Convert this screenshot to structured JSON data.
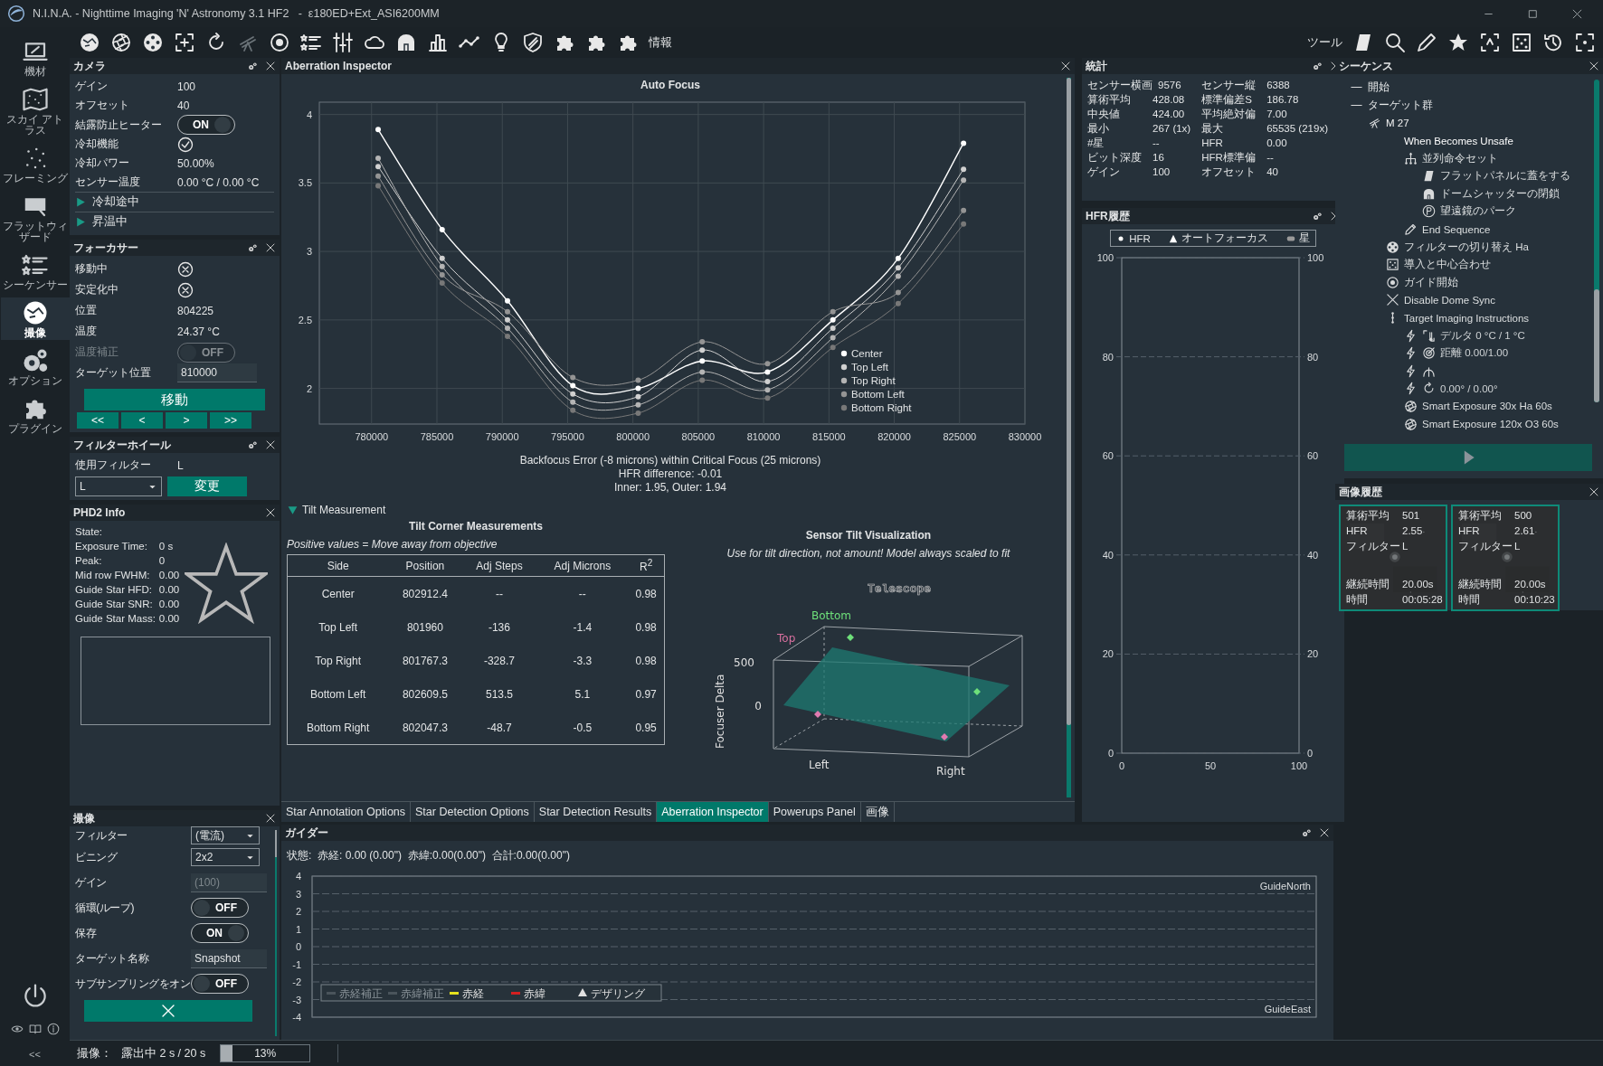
{
  "window": {
    "title": "N.I.N.A. - Nighttime Imaging 'N' Astronomy 3.1 HF2   -  ε180ED+Ext_ASI6200MM"
  },
  "nav": [
    {
      "label": "機材",
      "selected": false
    },
    {
      "label": "スカイ アトラス",
      "selected": false
    },
    {
      "label": "フレーミング",
      "selected": false
    },
    {
      "label": "フラットウィザード",
      "selected": false
    },
    {
      "label": "シーケンサー",
      "selected": false
    },
    {
      "label": "撮像",
      "selected": true
    },
    {
      "label": "オプション",
      "selected": false
    },
    {
      "label": "プラグイン",
      "selected": false
    }
  ],
  "nav_collapse": "<<",
  "toolbar": {
    "info_label": "情報",
    "tools_label": "ツール"
  },
  "camera": {
    "title": "カメラ",
    "settings_button": true,
    "rows": [
      {
        "kind": "text",
        "label": "ゲイン",
        "value": "100"
      },
      {
        "kind": "text",
        "label": "オフセット",
        "value": "40"
      },
      {
        "kind": "toggle",
        "label": "結露防止ヒーター",
        "value": "ON",
        "on": true,
        "disabled": false
      },
      {
        "kind": "check",
        "label": "冷却機能",
        "checked": true
      },
      {
        "kind": "text",
        "label": "冷却パワー",
        "value": "50.00%"
      },
      {
        "kind": "text",
        "label": "センサー温度",
        "value": "0.00 °C / 0.00 °C"
      },
      {
        "kind": "expander",
        "label": "冷却途中",
        "expanded": false
      },
      {
        "kind": "expander",
        "label": "昇温中",
        "expanded": false
      }
    ]
  },
  "focuser": {
    "title": "フォーカサー",
    "settings_button": true,
    "rows": [
      {
        "kind": "check",
        "label": "移動中",
        "checked": false
      },
      {
        "kind": "check",
        "label": "安定化中",
        "checked": false
      },
      {
        "kind": "text",
        "label": "位置",
        "value": "804225"
      },
      {
        "kind": "text",
        "label": "温度",
        "value": "24.37 °C"
      },
      {
        "kind": "toggle",
        "label": "温度補正",
        "value": "OFF",
        "on": false,
        "disabled": true
      },
      {
        "kind": "input",
        "label": "ターゲット位置",
        "value": "810000"
      }
    ],
    "move_button": "移動",
    "step_buttons": [
      "<<",
      "<",
      ">",
      ">>"
    ]
  },
  "filter_wheel": {
    "title": "フィルターホイール",
    "settings_button": true,
    "rows": [
      {
        "kind": "text",
        "label": "使用フィルター",
        "value": "L"
      }
    ],
    "filter_select": "L",
    "change_button": "変更"
  },
  "phd2": {
    "title": "PHD2 Info",
    "settings_button": false,
    "rows": [
      {
        "label": "State:"
      },
      {
        "label": "Exposure Time:",
        "value": "0 s"
      },
      {
        "label": "Peak:",
        "value": "0"
      },
      {
        "label": "Mid row FWHM:",
        "value": "0.00"
      },
      {
        "label": "Guide Star HFD:",
        "value": "0.00"
      },
      {
        "label": "Guide Star SNR:",
        "value": "0.00"
      },
      {
        "label": "Guide Star Mass:",
        "value": "0.00"
      }
    ]
  },
  "imaging": {
    "title": "撮像",
    "settings_button": false,
    "rows": [
      {
        "kind": "dropdown",
        "label": "フィルター",
        "value": "(電流)"
      },
      {
        "kind": "dropdown",
        "label": "ビニング",
        "value": "2x2"
      },
      {
        "kind": "input",
        "label": "ゲイン",
        "placeholder": "(100)"
      },
      {
        "kind": "toggle",
        "label": "循環(ループ)",
        "value": "OFF",
        "on": false,
        "disabled": false
      },
      {
        "kind": "toggle",
        "label": "保存",
        "value": "ON",
        "on": true,
        "disabled": false
      },
      {
        "kind": "input",
        "label": "ターゲット名称",
        "value": "Snapshot"
      },
      {
        "kind": "toggle",
        "label": "サブサンプリングをオン",
        "value": "OFF",
        "on": false,
        "disabled": false
      }
    ]
  },
  "aberration": {
    "title": "Aberration Inspector",
    "chart_data": {
      "type": "line",
      "title": "Auto Focus",
      "grid": true,
      "legend": "lower right",
      "xlim": [
        776000,
        830000
      ],
      "ylim": [
        1.74,
        4.09
      ],
      "xticks": [
        780000,
        785000,
        790000,
        795000,
        800000,
        805000,
        810000,
        815000,
        820000,
        825000,
        830000
      ],
      "yticks": [
        2,
        2.5,
        3,
        3.5,
        4
      ],
      "x": [
        780500,
        785400,
        790400,
        795400,
        800400,
        805300,
        810300,
        815300,
        820300,
        825300
      ],
      "series": [
        {
          "name": "Center",
          "color": "#ffffff",
          "marker": "circle",
          "values": [
            3.89,
            3.16,
            2.64,
            2.02,
            2.0,
            2.2,
            2.12,
            2.5,
            2.95,
            3.79
          ]
        },
        {
          "name": "Top Left",
          "color": "#d0d0d0",
          "marker": "circle",
          "values": [
            3.62,
            2.95,
            2.5,
            1.96,
            1.94,
            2.28,
            2.05,
            2.44,
            2.88,
            3.6
          ]
        },
        {
          "name": "Top Right",
          "color": "#b4b4b4",
          "marker": "circle",
          "values": [
            3.68,
            2.89,
            2.44,
            1.9,
            1.88,
            2.12,
            1.99,
            2.37,
            2.82,
            3.52
          ]
        },
        {
          "name": "Bottom Left",
          "color": "#949494",
          "marker": "circle",
          "values": [
            3.55,
            2.83,
            2.56,
            2.08,
            2.06,
            2.34,
            2.18,
            2.56,
            2.7,
            3.3
          ]
        },
        {
          "name": "Bottom Right",
          "color": "#787878",
          "marker": "circle",
          "values": [
            3.48,
            2.77,
            2.38,
            1.84,
            1.82,
            2.06,
            1.93,
            2.3,
            2.62,
            3.2
          ]
        }
      ]
    },
    "focus_summary": [
      "Backfocus Error (-8 microns) within Critical Focus (25 microns)",
      "HFR difference: -0.01",
      "Inner: 1.95, Outer: 1.94"
    ],
    "tilt": {
      "section": "Tilt Measurement",
      "expanded": true,
      "table_title": "Tilt Corner Measurements",
      "note": "Positive values = Move away from objective",
      "columns": [
        "Side",
        "Position",
        "Adj Steps",
        "Adj Microns",
        "R$^{2}$"
      ],
      "rows": [
        [
          "Center",
          "802912.4",
          "--",
          "--",
          "0.98"
        ],
        [
          "Top Left",
          "801960",
          "-136",
          "-1.4",
          "0.98"
        ],
        [
          "Top Right",
          "801767.3",
          "-328.7",
          "-3.3",
          "0.98"
        ],
        [
          "Bottom Left",
          "802609.5",
          "513.5",
          "5.1",
          "0.97"
        ],
        [
          "Bottom Right",
          "802047.3",
          "-48.7",
          "-0.5",
          "0.95"
        ]
      ]
    },
    "visual": {
      "title": "Sensor Tilt Visualization",
      "subtitle": "Use for tilt direction, not amount! Model always scaled to fit",
      "plot_title": "Telescope",
      "top": "Top",
      "bottom": "Bottom",
      "left": "Left",
      "right": "Right",
      "axis_label": "Focuser Delta",
      "ticks": [
        "500",
        "0"
      ]
    }
  },
  "center_tabs": [
    {
      "label": "Star Annotation Options",
      "selected": false
    },
    {
      "label": "Star Detection Options",
      "selected": false
    },
    {
      "label": "Star Detection Results",
      "selected": false
    },
    {
      "label": "Aberration Inspector",
      "selected": true
    },
    {
      "label": "Powerups Panel",
      "selected": false
    },
    {
      "label": "画像",
      "selected": false
    }
  ],
  "stats": {
    "title": "統計",
    "settings_button": true,
    "left": [
      {
        "label": "センサー横画",
        "value": "9576"
      },
      {
        "label": "算術平均",
        "value": "428.08"
      },
      {
        "label": "中央値",
        "value": "424.00"
      },
      {
        "label": "最小",
        "value": "267 (1x)"
      },
      {
        "label": "#星",
        "value": "--"
      },
      {
        "label": "ビット深度",
        "value": "16"
      },
      {
        "label": "ゲイン",
        "value": "100"
      }
    ],
    "right": [
      {
        "label": "センサー縦",
        "value": "6388"
      },
      {
        "label": "標準偏差S",
        "value": "186.78"
      },
      {
        "label": "平均絶対偏",
        "value": "7.00"
      },
      {
        "label": "最大",
        "value": "65535 (219x)"
      },
      {
        "label": "HFR",
        "value": "0.00"
      },
      {
        "label": "HFR標準偏",
        "value": "--"
      },
      {
        "label": "オフセット",
        "value": "40"
      }
    ]
  },
  "hfr_history": {
    "title": "HFR履歴",
    "settings_button": true,
    "chart_data": {
      "type": "line",
      "grid": true,
      "categories": [
        "0",
        "50",
        "100"
      ],
      "ylim": [
        0,
        100
      ],
      "yticks": [
        0,
        20,
        40,
        60,
        80,
        100
      ],
      "y2lim": [
        0,
        100
      ],
      "y2ticks": [
        0,
        20,
        40,
        60,
        80,
        100
      ],
      "series": [
        {
          "name": "HFR",
          "color": "#ffffff",
          "values": [
            null,
            null,
            null
          ]
        },
        {
          "name": "オートフォーカス",
          "color": "#ffffff",
          "values": [
            null,
            null,
            null
          ]
        },
        {
          "name": "星",
          "color": "#9a9a9a",
          "values": [
            null,
            null,
            null
          ]
        }
      ]
    }
  },
  "guider": {
    "title": "ガイダー",
    "settings_button": true,
    "status": "状態:  赤経: 0.00 (0.00\")  赤緯:0.00(0.00\")  合計:0.00(0.00\")",
    "chart_data": {
      "type": "line",
      "grid": true,
      "ylim": [
        -4,
        4
      ],
      "yticks": [
        -4,
        -3,
        -2,
        -1,
        0,
        1,
        2,
        3,
        4
      ],
      "series": [
        {
          "name": "赤経補正",
          "color": "#4a545b"
        },
        {
          "name": "赤緯補正",
          "color": "#4a545b"
        },
        {
          "name": "赤経",
          "color": "#e6e21e"
        },
        {
          "name": "赤緯",
          "color": "#d42020"
        }
      ]
    },
    "dither_label": "デザリング",
    "north_label": "GuideNorth",
    "east_label": "GuideEast"
  },
  "sequence": {
    "title": "シーケンス",
    "items": [
      {
        "kind": "container",
        "label": "開始",
        "expanded": true
      },
      {
        "kind": "container",
        "label": "ターゲット群",
        "expanded": true,
        "children": [
          {
            "kind": "target",
            "label": "M 27",
            "children": [
              {
                "kind": "condition",
                "label": "When Becomes Unsafe",
                "children": [
                  {
                    "kind": "instruction",
                    "label": "並列命令セット",
                    "children": [
                      {
                        "kind": "instruction",
                        "label": "フラットパネルに蓋をする"
                      },
                      {
                        "kind": "instruction",
                        "label": "ドームシャッターの閉鎖"
                      },
                      {
                        "kind": "instruction",
                        "label": "望遠鏡のパーク"
                      }
                    ]
                  },
                  {
                    "kind": "instruction",
                    "label": "End Sequence"
                  }
                ]
              },
              {
                "kind": "instruction",
                "label": "フィルターの切り替え Ha"
              },
              {
                "kind": "instruction",
                "label": "導入と中心合わせ"
              },
              {
                "kind": "instruction",
                "label": "ガイド開始"
              },
              {
                "kind": "instruction",
                "label": "Disable Dome Sync"
              },
              {
                "kind": "instruction",
                "label": "Target Imaging Instructions",
                "children": [
                  {
                    "kind": "trigger",
                    "label": "デルタ 0 °C / 1 °C"
                  },
                  {
                    "kind": "trigger",
                    "label": "距離 0.00/1.00"
                  },
                  {
                    "kind": "trigger"
                  },
                  {
                    "kind": "trigger",
                    "label": "0.00° / 0.00°"
                  },
                  {
                    "kind": "instruction",
                    "label": "Smart Exposure 30x Ha 60s"
                  },
                  {
                    "kind": "instruction",
                    "label": "Smart Exposure 120x O3 60s"
                  }
                ]
              }
            ]
          }
        ]
      }
    ]
  },
  "image_history": {
    "title": "画像履歴",
    "items": [
      {
        "stats": [
          {
            "label": "算術平均",
            "value": "501"
          },
          {
            "label": "HFR",
            "value": "2.55"
          },
          {
            "label": "フィルター",
            "value": "L"
          }
        ],
        "footer": [
          {
            "label": "継続時間",
            "value": "20.00s"
          },
          {
            "label": "時間",
            "value": "00:05:28"
          }
        ]
      },
      {
        "stats": [
          {
            "label": "算術平均",
            "value": "500"
          },
          {
            "label": "HFR",
            "value": "2.61"
          },
          {
            "label": "フィルター",
            "value": "L"
          }
        ],
        "footer": [
          {
            "label": "継続時間",
            "value": "20.00s"
          },
          {
            "label": "時間",
            "value": "00:10:23"
          }
        ]
      }
    ]
  },
  "status_bar": {
    "label": "撮像：",
    "text": "露出中 2 s / 20 s",
    "progress": {
      "level": 0.13,
      "text": "13%"
    }
  }
}
